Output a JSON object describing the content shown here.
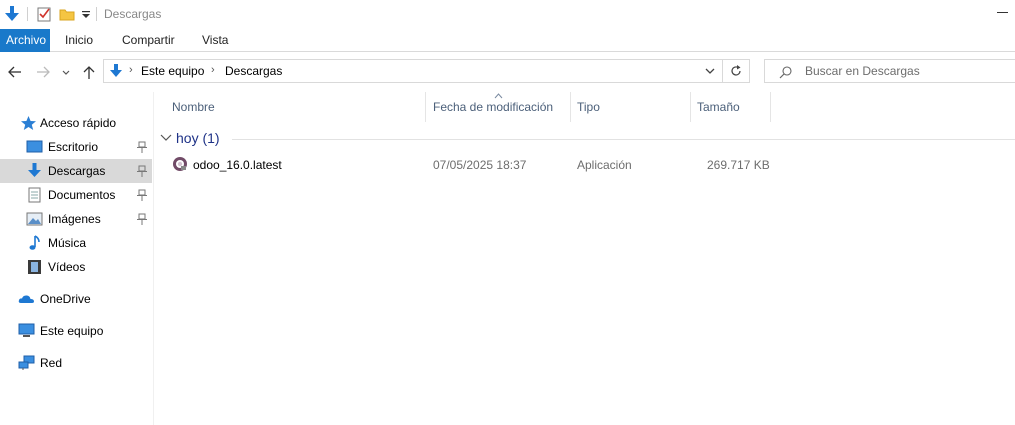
{
  "window": {
    "title": "Descargas"
  },
  "ribbon": {
    "tabs": [
      {
        "label": "Archivo"
      },
      {
        "label": "Inicio"
      },
      {
        "label": "Compartir"
      },
      {
        "label": "Vista"
      }
    ]
  },
  "address_bar": {
    "breadcrumbs": [
      "Este equipo",
      "Descargas"
    ]
  },
  "search": {
    "placeholder": "Buscar en Descargas"
  },
  "sidebar": {
    "items": [
      {
        "label": "Acceso rápido",
        "icon": "star-icon"
      },
      {
        "label": "Escritorio",
        "icon": "desktop-icon",
        "pinned": true
      },
      {
        "label": "Descargas",
        "icon": "download-icon",
        "pinned": true,
        "selected": true
      },
      {
        "label": "Documentos",
        "icon": "document-icon",
        "pinned": true
      },
      {
        "label": "Imágenes",
        "icon": "picture-icon",
        "pinned": true
      },
      {
        "label": "Música",
        "icon": "music-note-icon"
      },
      {
        "label": "Vídeos",
        "icon": "film-icon"
      },
      {
        "label": "OneDrive",
        "icon": "cloud-icon"
      },
      {
        "label": "Este equipo",
        "icon": "computer-icon"
      },
      {
        "label": "Red",
        "icon": "network-icon"
      }
    ]
  },
  "file_list": {
    "columns": [
      {
        "label": "Nombre"
      },
      {
        "label": "Fecha de modificación"
      },
      {
        "label": "Tipo"
      },
      {
        "label": "Tamaño"
      }
    ],
    "group": {
      "label": "hoy (1)"
    },
    "rows": [
      {
        "name": "odoo_16.0.latest",
        "modified": "07/05/2025 18:37",
        "type": "Aplicación",
        "size": "269.717 KB",
        "icon": "odoo-app-icon"
      }
    ]
  },
  "colors": {
    "accent": "#1979ca",
    "selection": "#d9d9d9",
    "group_label": "#1e3287",
    "column_header": "#4c607a"
  }
}
